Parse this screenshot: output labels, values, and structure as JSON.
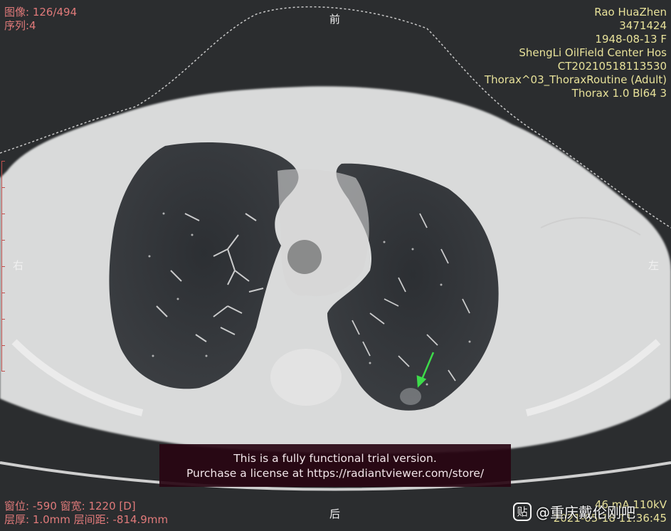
{
  "overlay": {
    "top_left": [
      "图像: 126/494",
      "序列:4"
    ],
    "top_right": [
      "Rao HuaZhen",
      "3471424",
      "1948-08-13 F",
      "ShengLi OilField Center Hos",
      "CT20210518113530",
      "Thorax^03_ThoraxRoutine (Adult)",
      "Thorax  1.0  Bl64  3"
    ],
    "bottom_left": [
      "窗位: -590 窗宽: 1220 [D]",
      "层厚: 1.0mm 层间距: -814.9mm"
    ],
    "bottom_right": [
      "46 mA 110kV",
      "2021-05-18 11:36:45"
    ]
  },
  "orientation": {
    "top": "前",
    "bottom": "后",
    "left": "右",
    "right": "左"
  },
  "trial_banner": [
    "This is a fully functional trial version.",
    "Purchase a license at https://radiantviewer.com/store/"
  ],
  "watermark": {
    "logo": "贴",
    "text": "@重庆戴伦刚吧"
  },
  "colors": {
    "overlay_left": "#e07a7a",
    "overlay_right": "#e8e29a",
    "arrow": "#3ddc4a",
    "banner_bg": "#28050f"
  }
}
